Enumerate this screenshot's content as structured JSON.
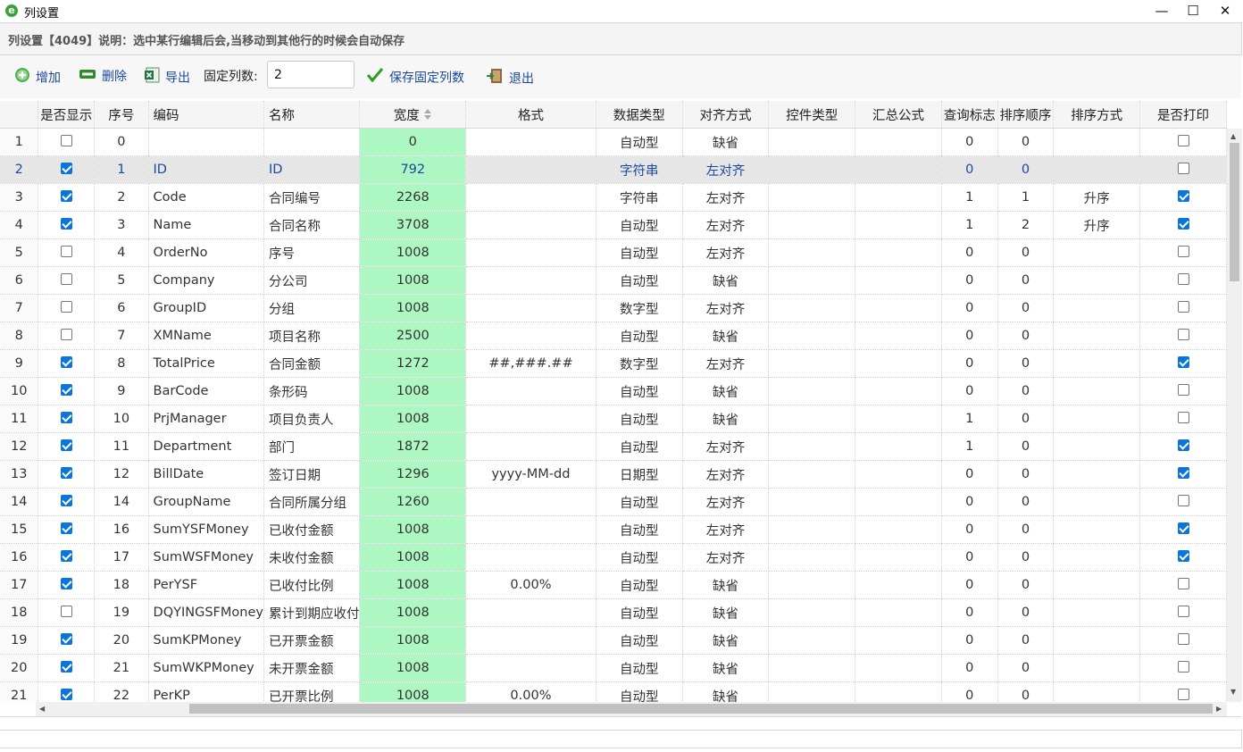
{
  "window": {
    "title": "列设置",
    "minimize": "—",
    "maximize": "☐",
    "close": "✕"
  },
  "info": {
    "text": "列设置【4049】说明：选中某行编辑后会,当移动到其他行的时候会自动保存"
  },
  "toolbar": {
    "add_label": "增加",
    "delete_label": "删除",
    "export_label": "导出",
    "fixed_cols_label": "固定列数:",
    "fixed_cols_value": "2",
    "save_fixed_label": "保存固定列数",
    "exit_label": "退出"
  },
  "columns": [
    "",
    "是否显示",
    "序号",
    "编码",
    "名称",
    "宽度",
    "格式",
    "数据类型",
    "对齐方式",
    "控件类型",
    "汇总公式",
    "查询标志",
    "排序顺序",
    "排序方式",
    "是否打印"
  ],
  "rows": [
    {
      "rn": "1",
      "show": false,
      "seq": "0",
      "code": "",
      "name": "",
      "width": "0",
      "format": "",
      "dtype": "自动型",
      "align": "缺省",
      "ctrl": "",
      "sum": "",
      "query": "0",
      "order": "0",
      "sort": "",
      "print": false
    },
    {
      "rn": "2",
      "show": true,
      "seq": "1",
      "code": "ID",
      "name": "ID",
      "width": "792",
      "format": "",
      "dtype": "字符串",
      "align": "左对齐",
      "ctrl": "",
      "sum": "",
      "query": "0",
      "order": "0",
      "sort": "",
      "print": false
    },
    {
      "rn": "3",
      "show": true,
      "seq": "2",
      "code": "Code",
      "name": "合同编号",
      "width": "2268",
      "format": "",
      "dtype": "字符串",
      "align": "左对齐",
      "ctrl": "",
      "sum": "",
      "query": "1",
      "order": "1",
      "sort": "升序",
      "print": true
    },
    {
      "rn": "4",
      "show": true,
      "seq": "3",
      "code": "Name",
      "name": "合同名称",
      "width": "3708",
      "format": "",
      "dtype": "自动型",
      "align": "左对齐",
      "ctrl": "",
      "sum": "",
      "query": "1",
      "order": "2",
      "sort": "升序",
      "print": true
    },
    {
      "rn": "5",
      "show": false,
      "seq": "4",
      "code": "OrderNo",
      "name": "序号",
      "width": "1008",
      "format": "",
      "dtype": "自动型",
      "align": "左对齐",
      "ctrl": "",
      "sum": "",
      "query": "0",
      "order": "0",
      "sort": "",
      "print": false
    },
    {
      "rn": "6",
      "show": false,
      "seq": "5",
      "code": "Company",
      "name": "分公司",
      "width": "1008",
      "format": "",
      "dtype": "自动型",
      "align": "缺省",
      "ctrl": "",
      "sum": "",
      "query": "0",
      "order": "0",
      "sort": "",
      "print": false
    },
    {
      "rn": "7",
      "show": false,
      "seq": "6",
      "code": "GroupID",
      "name": "分组",
      "width": "1008",
      "format": "",
      "dtype": "数字型",
      "align": "左对齐",
      "ctrl": "",
      "sum": "",
      "query": "0",
      "order": "0",
      "sort": "",
      "print": false
    },
    {
      "rn": "8",
      "show": false,
      "seq": "7",
      "code": "XMName",
      "name": "项目名称",
      "width": "2500",
      "format": "",
      "dtype": "自动型",
      "align": "缺省",
      "ctrl": "",
      "sum": "",
      "query": "0",
      "order": "0",
      "sort": "",
      "print": false
    },
    {
      "rn": "9",
      "show": true,
      "seq": "8",
      "code": "TotalPrice",
      "name": "合同金额",
      "width": "1272",
      "format": "##,###.##",
      "dtype": "数字型",
      "align": "左对齐",
      "ctrl": "",
      "sum": "",
      "query": "0",
      "order": "0",
      "sort": "",
      "print": true
    },
    {
      "rn": "10",
      "show": true,
      "seq": "9",
      "code": "BarCode",
      "name": "条形码",
      "width": "1008",
      "format": "",
      "dtype": "自动型",
      "align": "缺省",
      "ctrl": "",
      "sum": "",
      "query": "0",
      "order": "0",
      "sort": "",
      "print": false
    },
    {
      "rn": "11",
      "show": true,
      "seq": "10",
      "code": "PrjManager",
      "name": "项目负责人",
      "width": "1008",
      "format": "",
      "dtype": "自动型",
      "align": "缺省",
      "ctrl": "",
      "sum": "",
      "query": "1",
      "order": "0",
      "sort": "",
      "print": false
    },
    {
      "rn": "12",
      "show": true,
      "seq": "11",
      "code": "Department",
      "name": "部门",
      "width": "1872",
      "format": "",
      "dtype": "自动型",
      "align": "左对齐",
      "ctrl": "",
      "sum": "",
      "query": "1",
      "order": "0",
      "sort": "",
      "print": true
    },
    {
      "rn": "13",
      "show": true,
      "seq": "12",
      "code": "BillDate",
      "name": "签订日期",
      "width": "1296",
      "format": "yyyy-MM-dd",
      "dtype": "日期型",
      "align": "左对齐",
      "ctrl": "",
      "sum": "",
      "query": "0",
      "order": "0",
      "sort": "",
      "print": true
    },
    {
      "rn": "14",
      "show": true,
      "seq": "14",
      "code": "GroupName",
      "name": "合同所属分组",
      "width": "1260",
      "format": "",
      "dtype": "自动型",
      "align": "左对齐",
      "ctrl": "",
      "sum": "",
      "query": "0",
      "order": "0",
      "sort": "",
      "print": false
    },
    {
      "rn": "15",
      "show": true,
      "seq": "16",
      "code": "SumYSFMoney",
      "name": "已收付金额",
      "width": "1008",
      "format": "",
      "dtype": "自动型",
      "align": "左对齐",
      "ctrl": "",
      "sum": "",
      "query": "0",
      "order": "0",
      "sort": "",
      "print": true
    },
    {
      "rn": "16",
      "show": true,
      "seq": "17",
      "code": "SumWSFMoney",
      "name": "未收付金额",
      "width": "1008",
      "format": "",
      "dtype": "自动型",
      "align": "左对齐",
      "ctrl": "",
      "sum": "",
      "query": "0",
      "order": "0",
      "sort": "",
      "print": true
    },
    {
      "rn": "17",
      "show": true,
      "seq": "18",
      "code": "PerYSF",
      "name": "已收付比例",
      "width": "1008",
      "format": "0.00%",
      "dtype": "自动型",
      "align": "缺省",
      "ctrl": "",
      "sum": "",
      "query": "0",
      "order": "0",
      "sort": "",
      "print": false
    },
    {
      "rn": "18",
      "show": false,
      "seq": "19",
      "code": "DQYINGSFMoney",
      "name": "累计到期应收付",
      "width": "1008",
      "format": "",
      "dtype": "自动型",
      "align": "缺省",
      "ctrl": "",
      "sum": "",
      "query": "0",
      "order": "0",
      "sort": "",
      "print": false
    },
    {
      "rn": "19",
      "show": true,
      "seq": "20",
      "code": "SumKPMoney",
      "name": "已开票金额",
      "width": "1008",
      "format": "",
      "dtype": "自动型",
      "align": "缺省",
      "ctrl": "",
      "sum": "",
      "query": "0",
      "order": "0",
      "sort": "",
      "print": false
    },
    {
      "rn": "20",
      "show": true,
      "seq": "21",
      "code": "SumWKPMoney",
      "name": "未开票金额",
      "width": "1008",
      "format": "",
      "dtype": "自动型",
      "align": "缺省",
      "ctrl": "",
      "sum": "",
      "query": "0",
      "order": "0",
      "sort": "",
      "print": false
    },
    {
      "rn": "21",
      "show": true,
      "seq": "22",
      "code": "PerKP",
      "name": "已开票比例",
      "width": "1008",
      "format": "0.00%",
      "dtype": "自动型",
      "align": "缺省",
      "ctrl": "",
      "sum": "",
      "query": "0",
      "order": "0",
      "sort": "",
      "print": false
    }
  ],
  "selected_row": 1,
  "colors": {
    "width_column": "#adf8c2",
    "checkbox_on": "#0b75d9",
    "selected_row": "#e6e6e6",
    "link": "#1a49a0"
  },
  "icons": [
    "add-icon",
    "delete-icon",
    "excel-export-icon",
    "checkmark-icon",
    "exit-door-icon",
    "sort-icon",
    "app-ie-icon"
  ]
}
